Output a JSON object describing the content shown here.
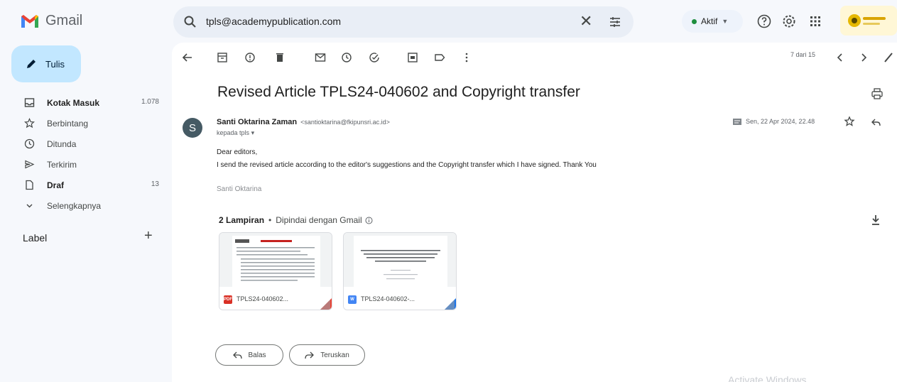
{
  "app": {
    "name": "Gmail"
  },
  "search": {
    "value": "tpls@academypublication.com"
  },
  "status": {
    "label": "Aktif",
    "color": "#1e8e3e"
  },
  "sidebar": {
    "compose_label": "Tulis",
    "items": [
      {
        "label": "Kotak Masuk",
        "count": "1.078",
        "icon": "inbox-icon"
      },
      {
        "label": "Berbintang",
        "count": "",
        "icon": "star-icon"
      },
      {
        "label": "Ditunda",
        "count": "",
        "icon": "clock-icon"
      },
      {
        "label": "Terkirim",
        "count": "",
        "icon": "send-icon"
      },
      {
        "label": "Draf",
        "count": "13",
        "icon": "draft-icon"
      },
      {
        "label": "Selengkapnya",
        "count": "",
        "icon": "chevron-down-icon"
      }
    ],
    "labels_heading": "Label"
  },
  "toolbar": {
    "pager": "7 dari 15"
  },
  "email": {
    "subject": "Revised Article TPLS24-040602 and Copyright transfer",
    "sender_initial": "S",
    "sender_name": "Santi Oktarina Zaman",
    "sender_email": "<santioktarina@fkipunsri.ac.id>",
    "recipient": "kepada tpls",
    "date": "Sen, 22 Apr 2024, 22.48",
    "body_greeting": "Dear editors,",
    "body_text": "I send the revised article according to the editor's suggestions and the Copyright transfer which I have signed. Thank You",
    "signature": "Santi Oktarina"
  },
  "attachments": {
    "count_label": "2 Lampiran",
    "scanned_label": "Dipindai dengan Gmail",
    "files": [
      {
        "name": "TPLS24-040602...",
        "type": "PDF",
        "badge_color": "#d93025",
        "preview_title": "Copyright Transfer Agreement"
      },
      {
        "name": "TPLS24-040602-...",
        "type": "W",
        "badge_color": "#4285f4",
        "preview_title": "The Development of Blended Learning Model Combined with Project Based Learning Model in Indonesian Students' Scientific Writing"
      }
    ]
  },
  "actions": {
    "reply_label": "Balas",
    "forward_label": "Teruskan"
  },
  "watermark": "Activate Windows"
}
